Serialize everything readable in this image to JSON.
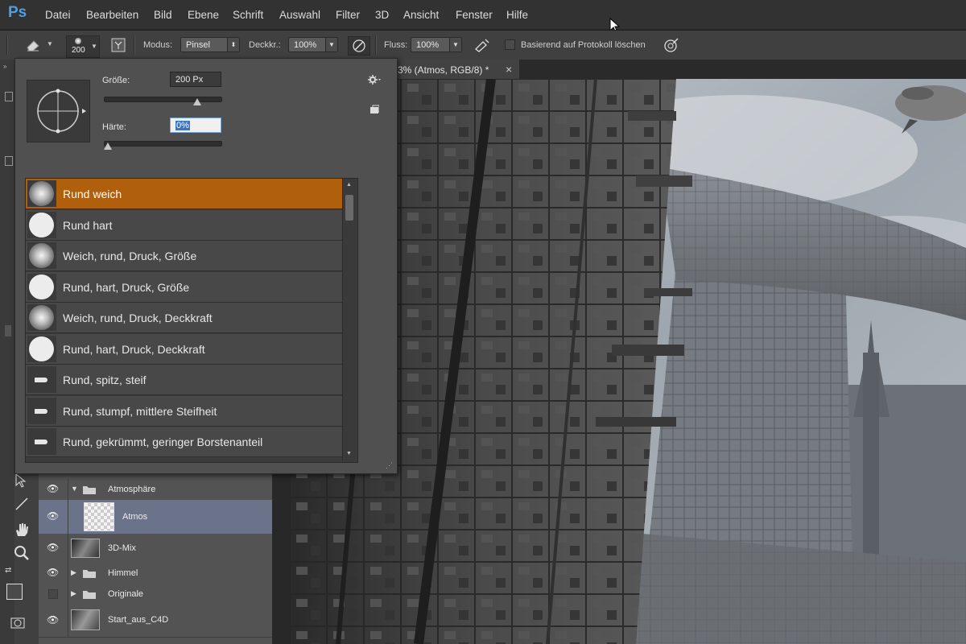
{
  "app": {
    "logo": "Ps"
  },
  "menu": [
    "Datei",
    "Bearbeiten",
    "Bild",
    "Ebene",
    "Schrift",
    "Auswahl",
    "Filter",
    "3D",
    "Ansicht",
    "Fenster",
    "Hilfe"
  ],
  "options": {
    "brush_size": "200",
    "mode_label": "Modus:",
    "mode_value": "Pinsel",
    "opacity_label": "Deckkr.:",
    "opacity_value": "100%",
    "flow_label": "Fluss:",
    "flow_value": "100%",
    "history_label": "Basierend auf Protokoll löschen"
  },
  "document_tab": {
    "title": "3% (Atmos, RGB/8) *",
    "close": "×"
  },
  "brush_panel": {
    "size_label": "Größe:",
    "size_value": "200 Px",
    "size_fraction": 0.82,
    "hardness_label": "Härte:",
    "hardness_value": "0%",
    "hardness_fraction": 0.0,
    "presets": [
      {
        "name": "Rund weich",
        "kind": "soft",
        "selected": true
      },
      {
        "name": "Rund hart",
        "kind": "hard",
        "selected": false
      },
      {
        "name": "Weich, rund, Druck, Größe",
        "kind": "soft",
        "selected": false
      },
      {
        "name": "Rund, hart, Druck, Größe",
        "kind": "hard",
        "selected": false
      },
      {
        "name": "Weich, rund, Druck, Deckkraft",
        "kind": "soft",
        "selected": false
      },
      {
        "name": "Rund, hart, Druck, Deckkraft",
        "kind": "hard",
        "selected": false
      },
      {
        "name": "Rund, spitz, steif",
        "kind": "bristle",
        "selected": false
      },
      {
        "name": "Rund, stumpf, mittlere Steifheit",
        "kind": "bristle",
        "selected": false
      },
      {
        "name": "Rund, gekrümmt, geringer Borstenanteil",
        "kind": "bristle",
        "selected": false
      }
    ]
  },
  "layers": [
    {
      "name": "Atmosphäre",
      "type": "group",
      "expanded": true,
      "visible": true,
      "selected": false
    },
    {
      "name": "Atmos",
      "type": "layer",
      "visible": true,
      "selected": true
    },
    {
      "name": "3D-Mix",
      "type": "layer",
      "visible": true,
      "selected": false
    },
    {
      "name": "Himmel",
      "type": "group",
      "expanded": false,
      "visible": true,
      "selected": false
    },
    {
      "name": "Originale",
      "type": "group",
      "expanded": false,
      "visible": false,
      "selected": false
    },
    {
      "name": "Start_aus_C4D",
      "type": "layer",
      "visible": true,
      "selected": false
    }
  ],
  "colors": {
    "selection_accent": "#b0600c",
    "layer_selected": "#6a7389",
    "logo_blue": "#4d9fe8"
  }
}
